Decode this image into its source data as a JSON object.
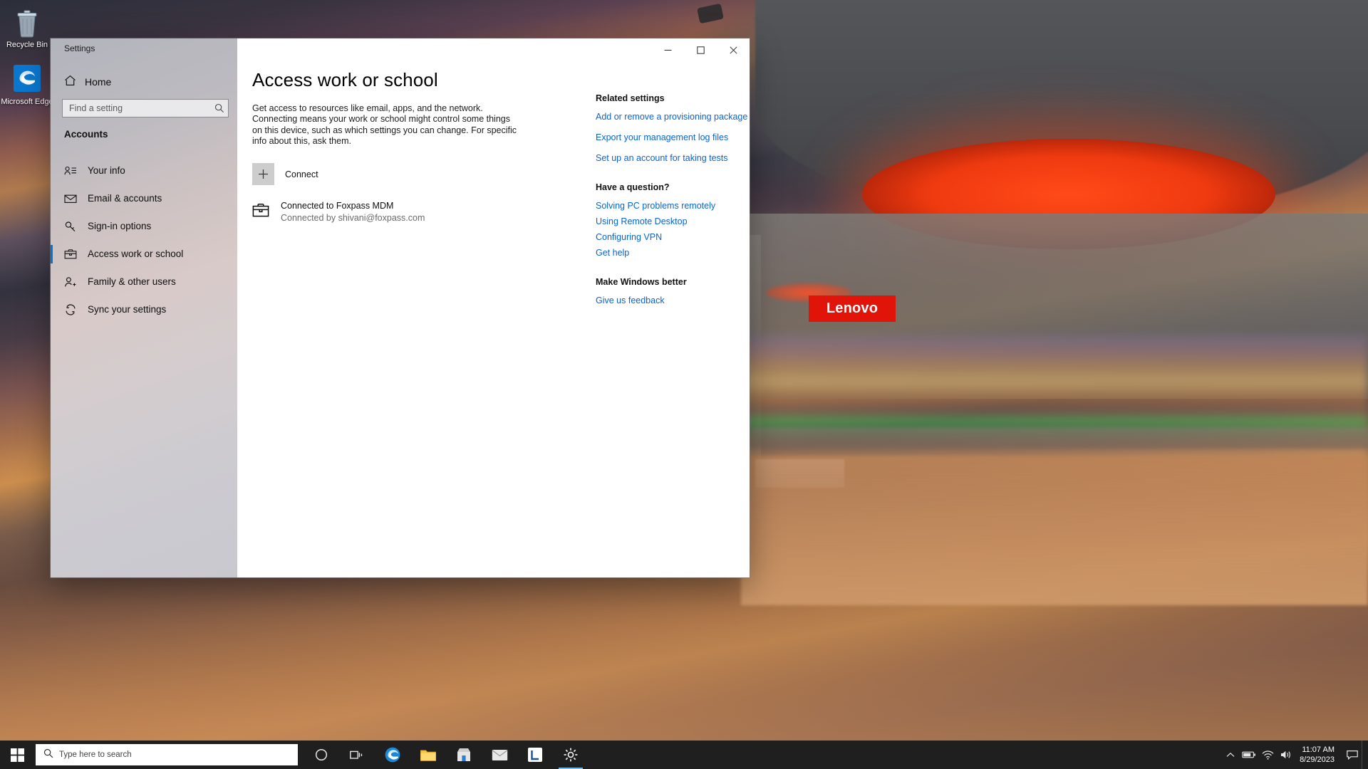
{
  "desktop": {
    "icons": [
      {
        "name": "recycle-bin",
        "label": "Recycle Bin"
      },
      {
        "name": "microsoft-edge",
        "label": "Microsoft Edge"
      }
    ],
    "wallpaper_sign": "Lenovo"
  },
  "window": {
    "app_title": "Settings",
    "caption": {
      "minimize": "–",
      "maximize": "□",
      "close": "✕"
    }
  },
  "sidebar": {
    "home_label": "Home",
    "search": {
      "placeholder": "Find a setting",
      "value": ""
    },
    "category": "Accounts",
    "items": [
      {
        "label": "Your info",
        "icon": "contact-card-icon",
        "selected": false
      },
      {
        "label": "Email & accounts",
        "icon": "envelope-icon",
        "selected": false
      },
      {
        "label": "Sign-in options",
        "icon": "key-icon",
        "selected": false
      },
      {
        "label": "Access work or school",
        "icon": "briefcase-icon",
        "selected": true
      },
      {
        "label": "Family & other users",
        "icon": "person-add-icon",
        "selected": false
      },
      {
        "label": "Sync your settings",
        "icon": "sync-icon",
        "selected": false
      }
    ],
    "accent_color": "#0078d7"
  },
  "main": {
    "title": "Access work or school",
    "description": "Get access to resources like email, apps, and the network. Connecting means your work or school might control some things on this device, such as which settings you can change. For specific info about this, ask them.",
    "connect_label": "Connect",
    "connect_icon": "plus-icon",
    "connection": {
      "icon": "briefcase-icon",
      "title": "Connected to Foxpass MDM",
      "subtitle": "Connected by shivani@foxpass.com"
    }
  },
  "aside": {
    "link_color": "#0b63ce",
    "blocks": [
      {
        "heading": "Related settings",
        "links": [
          "Add or remove a provisioning package",
          "Export your management log files",
          "Set up an account for taking tests"
        ]
      },
      {
        "heading": "Have a question?",
        "links": [
          "Solving PC problems remotely",
          "Using Remote Desktop",
          "Configuring VPN",
          "Get help"
        ]
      },
      {
        "heading": "Make Windows better",
        "links": [
          "Give us feedback"
        ]
      }
    ]
  },
  "taskbar": {
    "start_label": "start-button",
    "search_placeholder": "Type here to search",
    "buttons": [
      {
        "name": "cortana-button",
        "icon": "circle-icon"
      },
      {
        "name": "task-view-button",
        "icon": "task-view-icon"
      },
      {
        "name": "edge-button",
        "icon": "edge-icon"
      },
      {
        "name": "file-explorer-button",
        "icon": "folder-icon"
      },
      {
        "name": "microsoft-store-button",
        "icon": "store-icon"
      },
      {
        "name": "mail-button",
        "icon": "mail-icon"
      },
      {
        "name": "lenovo-vantage-button",
        "icon": "lenovo-icon"
      },
      {
        "name": "settings-button",
        "icon": "gear-icon"
      }
    ],
    "tray": [
      {
        "name": "show-hidden-icons",
        "icon": "chevron-up-icon"
      },
      {
        "name": "battery-icon",
        "icon": "battery-icon"
      },
      {
        "name": "network-icon",
        "icon": "wifi-icon"
      },
      {
        "name": "volume-icon",
        "icon": "speaker-icon"
      }
    ],
    "clock": {
      "time": "11:07 AM",
      "date": "8/29/2023"
    },
    "action_center": "notification-icon"
  }
}
